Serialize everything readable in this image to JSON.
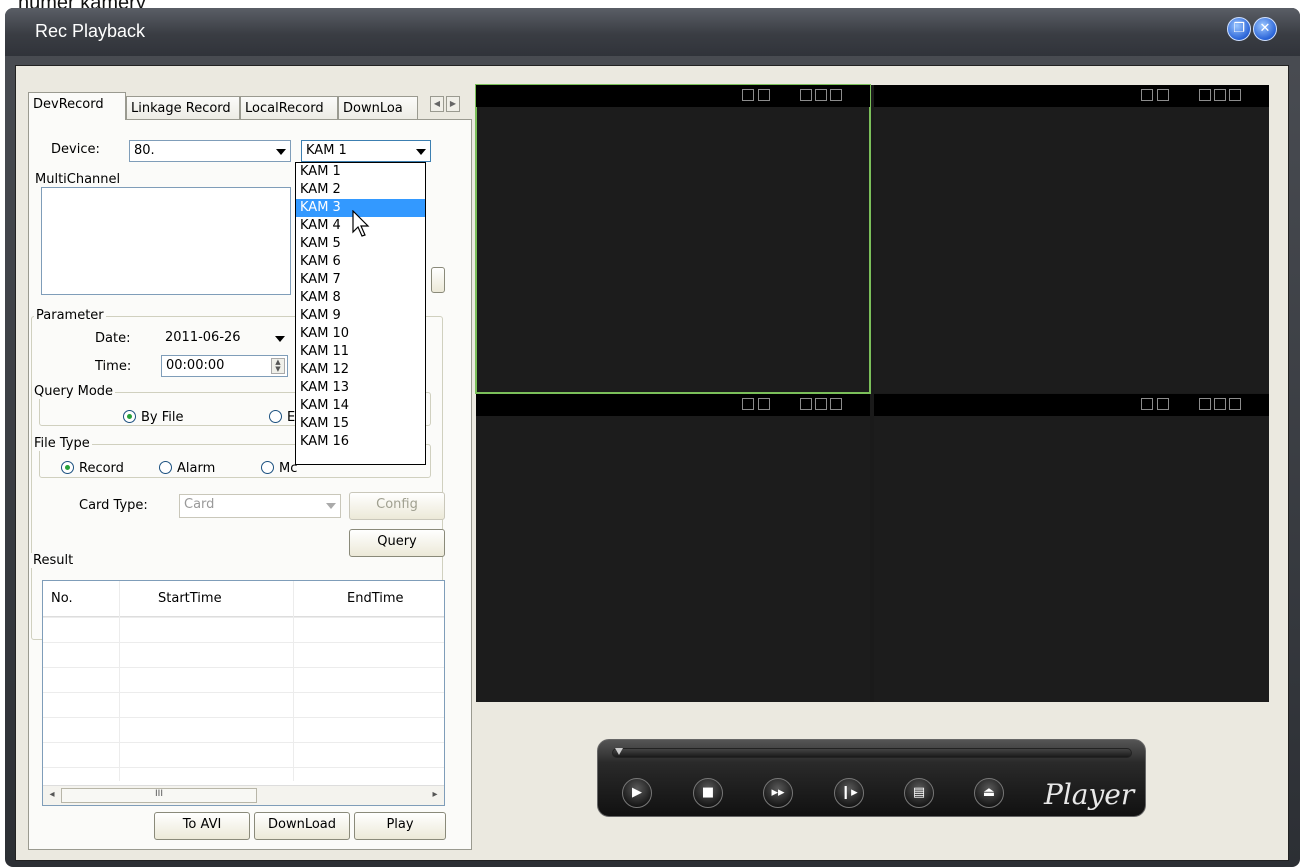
{
  "caption": "numer kamery",
  "window": {
    "title": "Rec Playback"
  },
  "tabs": [
    "DevRecord",
    "Linkage Record",
    "LocalRecord",
    "DownLoa"
  ],
  "device": {
    "label": "Device:",
    "value": "80.",
    "channel_value": "KAM 1"
  },
  "channel_dropdown": {
    "options": [
      "KAM 1",
      "KAM 2",
      "KAM 3",
      "KAM 4",
      "KAM 5",
      "KAM 6",
      "KAM 7",
      "KAM 8",
      "KAM 9",
      "KAM 10",
      "KAM 11",
      "KAM 12",
      "KAM 13",
      "KAM 14",
      "KAM 15",
      "KAM 16"
    ],
    "highlighted": "KAM 3"
  },
  "multichannel": {
    "title": "MultiChannel"
  },
  "parameter": {
    "title": "Parameter",
    "date_label": "Date:",
    "date_value": "2011-06-26",
    "time_label": "Time:",
    "time_value": "00:00:00"
  },
  "query_mode": {
    "title": "Query Mode",
    "by_file": "By File",
    "second_option_partial": "E"
  },
  "file_type": {
    "title": "File Type",
    "record": "Record",
    "alarm": "Alarm",
    "third_partial": "Mc"
  },
  "card": {
    "label": "Card Type:",
    "value": "Card",
    "config_label": "Config"
  },
  "query_button": "Query",
  "result": {
    "title": "Result",
    "columns": [
      "No.",
      "StartTime",
      "EndTime"
    ],
    "scroll_thumb": "III"
  },
  "actions": {
    "to_avi": "To AVI",
    "download": "DownLoad",
    "play": "Play"
  },
  "player": {
    "brand": "Player"
  },
  "colors": {
    "selected_pane_border": "#7bbf5a",
    "dropdown_highlight": "#3399ff",
    "window_frame": "#3a3d43",
    "panel_bg": "#ebe9e0"
  }
}
